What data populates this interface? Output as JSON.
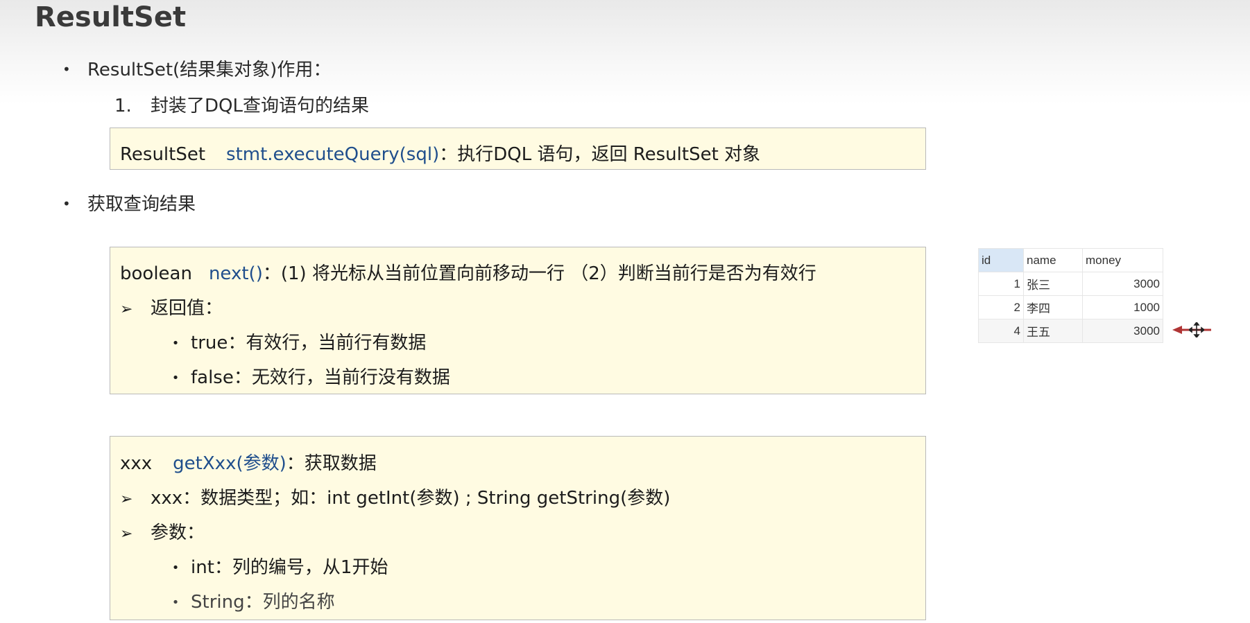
{
  "title": "ResultSet",
  "section1": {
    "bullet": "ResultSet(结果集对象)作用：",
    "item_num": "1.",
    "item_text": "封装了DQL查询语句的结果"
  },
  "box1": {
    "type": "ResultSet",
    "method": "stmt.executeQuery(sql)",
    "desc": "：执行DQL 语句，返回 ResultSet 对象"
  },
  "section2": {
    "bullet": "获取查询结果"
  },
  "box2": {
    "type": "boolean",
    "method": "next()",
    "desc": "：(1) 将光标从当前位置向前移动一行 （2）判断当前行是否为有效行",
    "return_label": "返回值：",
    "true_text": "true：有效行，当前行有数据",
    "false_text": "false：无效行，当前行没有数据"
  },
  "box3": {
    "type": "xxx",
    "method": "getXxx(参数)",
    "desc": "：获取数据",
    "line2": "xxx：数据类型；如：int getInt(参数) ; String getString(参数)",
    "line3": "参数：",
    "int_text": "int：列的编号，从1开始",
    "string_text": "String：列的名称"
  },
  "table": {
    "headers": [
      "id",
      "name",
      "money"
    ],
    "rows": [
      [
        "1",
        "张三",
        "3000"
      ],
      [
        "2",
        "李四",
        "1000"
      ],
      [
        "4",
        "王五",
        "3000"
      ]
    ]
  },
  "colors": {
    "method_blue": "#1f4e8c",
    "box_bg": "#fffbe2",
    "arrow_red": "#b03535"
  },
  "icons": {
    "arrow": "red-left-arrow-icon",
    "cursor": "move-cursor-icon"
  }
}
